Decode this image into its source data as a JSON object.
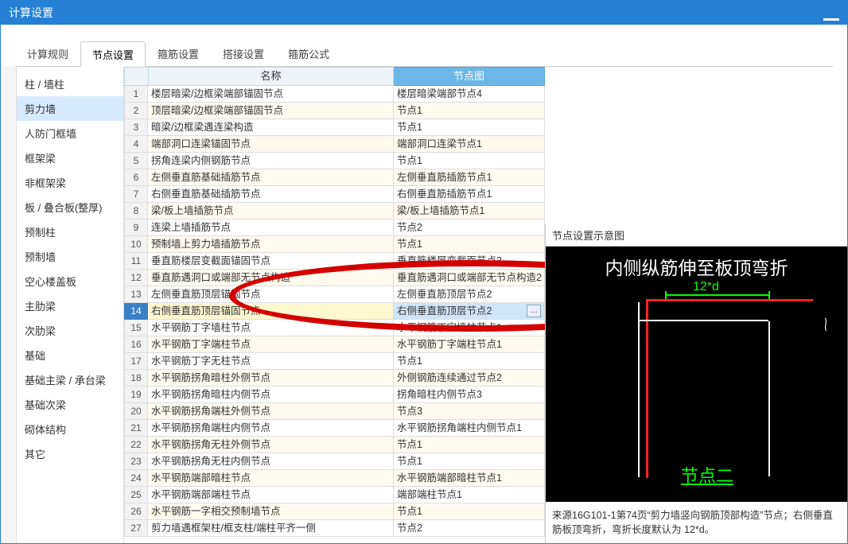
{
  "window_title": "计算设置",
  "tabs": [
    "计算规则",
    "节点设置",
    "箍筋设置",
    "搭接设置",
    "箍筋公式"
  ],
  "active_tab": 1,
  "sidebar": {
    "items": [
      "柱 / 墙柱",
      "剪力墙",
      "人防门框墙",
      "框架梁",
      "非框架梁",
      "板 / 叠合板(整厚)",
      "预制柱",
      "预制墙",
      "空心楼盖板",
      "主肋梁",
      "次肋梁",
      "基础",
      "基础主梁 / 承台梁",
      "基础次梁",
      "砌体结构",
      "其它"
    ],
    "active": 1
  },
  "table": {
    "col_name": "名称",
    "col_diag": "节点图",
    "rows": [
      {
        "i": 1,
        "name": "楼层暗梁/边框梁端部锚固节点",
        "diag": "楼层暗梁端部节点4"
      },
      {
        "i": 2,
        "name": "顶层暗梁/边框梁端部锚固节点",
        "diag": "节点1"
      },
      {
        "i": 3,
        "name": "暗梁/边框梁遇连梁构造",
        "diag": "节点1"
      },
      {
        "i": 4,
        "name": "端部洞口连梁锚固节点",
        "diag": "端部洞口连梁节点1"
      },
      {
        "i": 5,
        "name": "拐角连梁内侧钢筋节点",
        "diag": "节点1"
      },
      {
        "i": 6,
        "name": "左侧垂直筋基础插筋节点",
        "diag": "左侧垂直筋插筋节点1"
      },
      {
        "i": 7,
        "name": "右侧垂直筋基础插筋节点",
        "diag": "右侧垂直筋插筋节点1"
      },
      {
        "i": 8,
        "name": "梁/板上墙插筋节点",
        "diag": "梁/板上墙插筋节点1"
      },
      {
        "i": 9,
        "name": "连梁上墙插筋节点",
        "diag": "节点2"
      },
      {
        "i": 10,
        "name": "预制墙上剪力墙插筋节点",
        "diag": "节点1"
      },
      {
        "i": 11,
        "name": "垂直筋楼层变截面锚固节点",
        "diag": "垂直筋楼层变截面节点3"
      },
      {
        "i": 12,
        "name": "垂直筋遇洞口或端部无节点构造",
        "diag": "垂直筋遇洞口或端部无节点构造2"
      },
      {
        "i": 13,
        "name": "左侧垂直筋顶层锚固节点",
        "diag": "左侧垂直筋顶层节点2"
      },
      {
        "i": 14,
        "name": "右侧垂直筋顶层锚固节点",
        "diag": "右侧垂直筋顶层节点2"
      },
      {
        "i": 15,
        "name": "水平钢筋丁字墙柱节点",
        "diag": "水平钢筋丁字墙柱节点1"
      },
      {
        "i": 16,
        "name": "水平钢筋丁字端柱节点",
        "diag": "水平钢筋丁字端柱节点1"
      },
      {
        "i": 17,
        "name": "水平钢筋丁字无柱节点",
        "diag": "节点1"
      },
      {
        "i": 18,
        "name": "水平钢筋拐角暗柱外侧节点",
        "diag": "外侧钢筋连续通过节点2"
      },
      {
        "i": 19,
        "name": "水平钢筋拐角暗柱内侧节点",
        "diag": "拐角暗柱内侧节点3"
      },
      {
        "i": 20,
        "name": "水平钢筋拐角端柱外侧节点",
        "diag": "节点3"
      },
      {
        "i": 21,
        "name": "水平钢筋拐角端柱内侧节点",
        "diag": "水平钢筋拐角端柱内侧节点1"
      },
      {
        "i": 22,
        "name": "水平钢筋拐角无柱外侧节点",
        "diag": "节点1"
      },
      {
        "i": 23,
        "name": "水平钢筋拐角无柱内侧节点",
        "diag": "节点1"
      },
      {
        "i": 24,
        "name": "水平钢筋端部暗柱节点",
        "diag": "水平钢筋端部暗柱节点1"
      },
      {
        "i": 25,
        "name": "水平钢筋端部端柱节点",
        "diag": "端部端柱节点1"
      },
      {
        "i": 26,
        "name": "水平钢筋一字相交预制墙节点",
        "diag": "节点1"
      },
      {
        "i": 27,
        "name": "剪力墙遇框架柱/框支柱/端柱平齐一侧",
        "diag": "节点2"
      }
    ],
    "selected": 14
  },
  "preview": {
    "title": "节点设置示意图",
    "heading": "内侧纵筋伸至板顶弯折",
    "dimension": "12*d",
    "label": "节点二",
    "note": "来源16G101-1第74页“剪力墙竖向钢筋顶部构造”节点；右侧垂直筋板顶弯折，弯折长度默认为 12*d。"
  }
}
